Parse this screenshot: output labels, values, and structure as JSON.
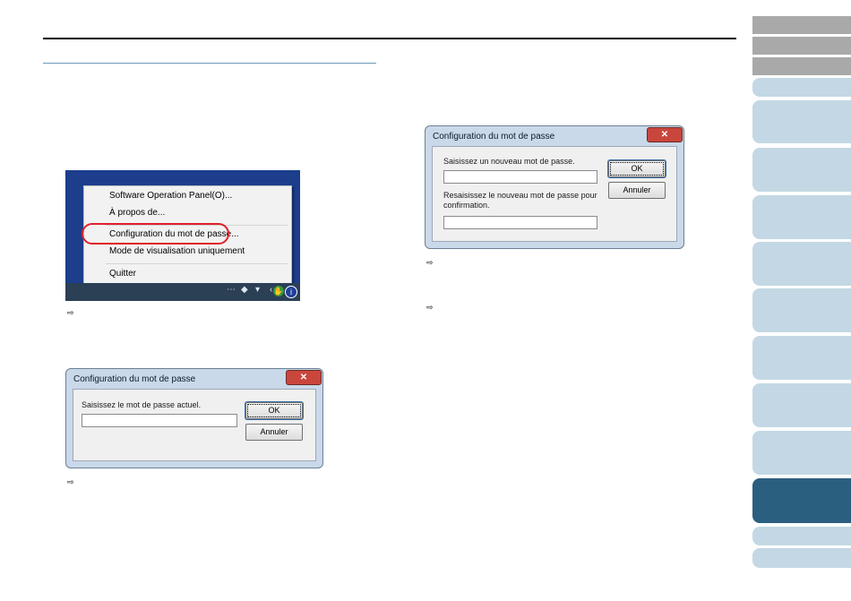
{
  "nav_tabs": [
    "",
    "",
    "",
    "",
    "",
    "",
    "",
    "",
    "",
    "",
    "",
    "",
    "",
    ""
  ],
  "tray_menu": {
    "items": [
      "Software Operation Panel(O)...",
      "À propos de...",
      "Configuration du mot de passe...",
      "Mode de visualisation uniquement",
      "Quitter"
    ],
    "highlighted_index": 2
  },
  "dialog_current": {
    "title": "Configuration du mot de passe",
    "close_glyph": "✕",
    "prompt": "Saisissez le mot de passe actuel.",
    "input_value": "",
    "ok_label": "OK",
    "cancel_label": "Annuler"
  },
  "dialog_new": {
    "title": "Configuration du mot de passe",
    "close_glyph": "✕",
    "prompt_new": "Saisissez un nouveau mot de passe.",
    "input_new_value": "",
    "prompt_confirm": "Resaisissez le nouveau mot de passe pour confirmation.",
    "input_confirm_value": "",
    "ok_label": "OK",
    "cancel_label": "Annuler"
  },
  "step_arrow": "⇨",
  "colors": {
    "accent": "#2b5f80",
    "tab_light": "#c3d8e4",
    "tab_gray": "#a9a9a9",
    "highlight_oval": "#e0202a"
  }
}
